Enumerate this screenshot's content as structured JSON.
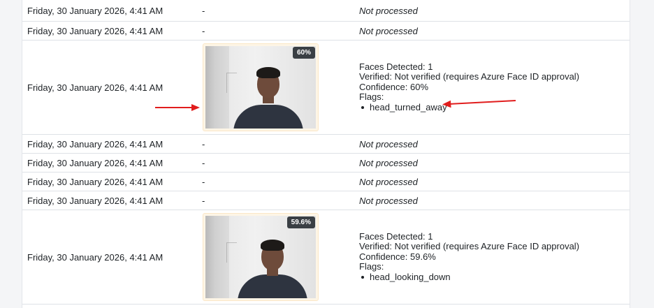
{
  "rows": [
    {
      "time": "Friday, 30 January 2026, 4:41 AM",
      "snapshot": "-",
      "result": "Not processed"
    },
    {
      "time": "Friday, 30 January 2026, 4:41 AM",
      "snapshot": "-",
      "result": "Not processed"
    },
    {
      "time": "Friday, 30 January 2026, 4:41 AM",
      "confidence_badge": "60%",
      "faces_detected": "Faces Detected: 1",
      "verified": "Verified: Not verified (requires Azure Face ID approval)",
      "confidence": "Confidence: 60%",
      "flags_label": "Flags:",
      "flags": [
        "head_turned_away"
      ]
    },
    {
      "time": "Friday, 30 January 2026, 4:41 AM",
      "snapshot": "-",
      "result": "Not processed"
    },
    {
      "time": "Friday, 30 January 2026, 4:41 AM",
      "snapshot": "-",
      "result": "Not processed"
    },
    {
      "time": "Friday, 30 January 2026, 4:41 AM",
      "snapshot": "-",
      "result": "Not processed"
    },
    {
      "time": "Friday, 30 January 2026, 4:41 AM",
      "snapshot": "-",
      "result": "Not processed"
    },
    {
      "time": "Friday, 30 January 2026, 4:41 AM",
      "confidence_badge": "59.6%",
      "faces_detected": "Faces Detected: 1",
      "verified": "Verified: Not verified (requires Azure Face ID approval)",
      "confidence": "Confidence: 59.6%",
      "flags_label": "Flags:",
      "flags": [
        "head_looking_down"
      ]
    }
  ],
  "colors": {
    "annotation_arrow": "#e11d1d",
    "badge_bg": "#3a3f44",
    "snapshot_frame": "#fdf5e6"
  },
  "icons": {
    "annotation": "red-arrow-icon"
  }
}
